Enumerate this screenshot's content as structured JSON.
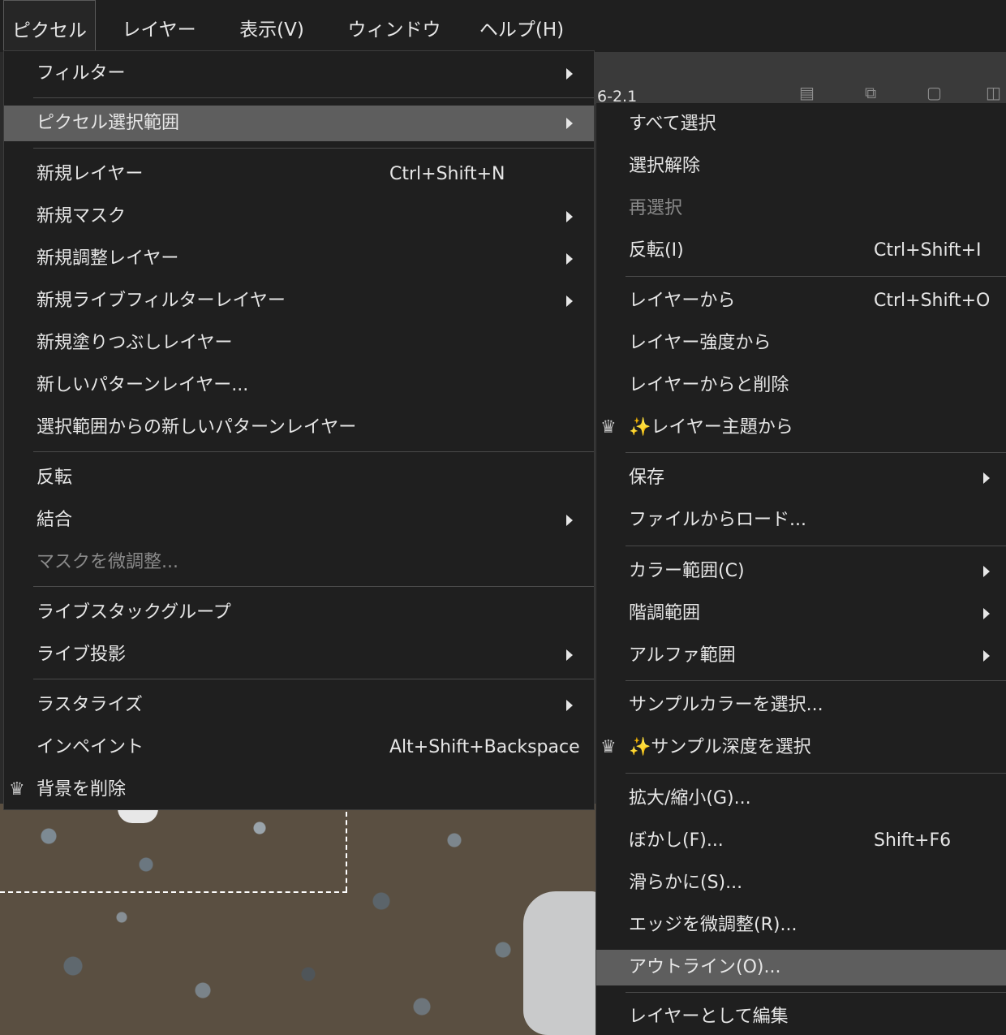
{
  "menubar": [
    {
      "label": "ピクセル",
      "active": true
    },
    {
      "label": "レイヤー(L)"
    },
    {
      "label": "表示(V)"
    },
    {
      "label": "ウィンドウ(W)"
    },
    {
      "label": "ヘルプ(H)"
    }
  ],
  "document_tab": "6-2.1",
  "main_menu": {
    "filter": "フィルター",
    "pixel_selection": "ピクセル選択範囲",
    "new_layer": "新規レイヤー",
    "new_layer_shortcut": "Ctrl+Shift+N",
    "new_mask": "新規マスク",
    "new_adjustment_layer": "新規調整レイヤー",
    "new_live_filter_layer": "新規ライブフィルターレイヤー",
    "new_fill_layer": "新規塗りつぶしレイヤー",
    "new_pattern_layer": "新しいパターンレイヤー...",
    "new_pattern_from_selection": "選択範囲からの新しいパターンレイヤー",
    "invert": "反転",
    "merge": "結合",
    "refine_mask": "マスクを微調整...",
    "live_stack_group": "ライブスタックグループ",
    "live_projection": "ライブ投影",
    "rasterize": "ラスタライズ",
    "inpaint": "インペイント",
    "inpaint_shortcut": "Alt+Shift+Backspace",
    "remove_background": "背景を削除"
  },
  "sub_menu": {
    "select_all": "すべて選択",
    "deselect": "選択解除",
    "reselect": "再選択",
    "invert": "反転(I)",
    "invert_shortcut": "Ctrl+Shift+I",
    "from_layer": "レイヤーから",
    "from_layer_shortcut": "Ctrl+Shift+O",
    "from_layer_intensity": "レイヤー強度から",
    "from_layer_and_delete": "レイヤーからと削除",
    "from_layer_subject": "✨レイヤー主題から",
    "save": "保存",
    "load_from_file": "ファイルからロード...",
    "color_range": "カラー範囲(C)",
    "tonal_range": "階調範囲",
    "alpha_range": "アルファ範囲",
    "select_sampled_color": "サンプルカラーを選択...",
    "select_sampled_depth": "✨サンプル深度を選択",
    "grow_shrink": "拡大/縮小(G)...",
    "feather": "ぼかし(F)...",
    "feather_shortcut": "Shift+F6",
    "smooth": "滑らかに(S)...",
    "refine_edges": "エッジを微調整(R)...",
    "outline": "アウトライン(O)...",
    "edit_as_layer": "レイヤーとして編集"
  },
  "colors": {
    "menu_bg": "#1f1f1f",
    "highlight": "#5e5e5e",
    "text": "#e6e6e6",
    "disabled": "#8a8a8a"
  }
}
